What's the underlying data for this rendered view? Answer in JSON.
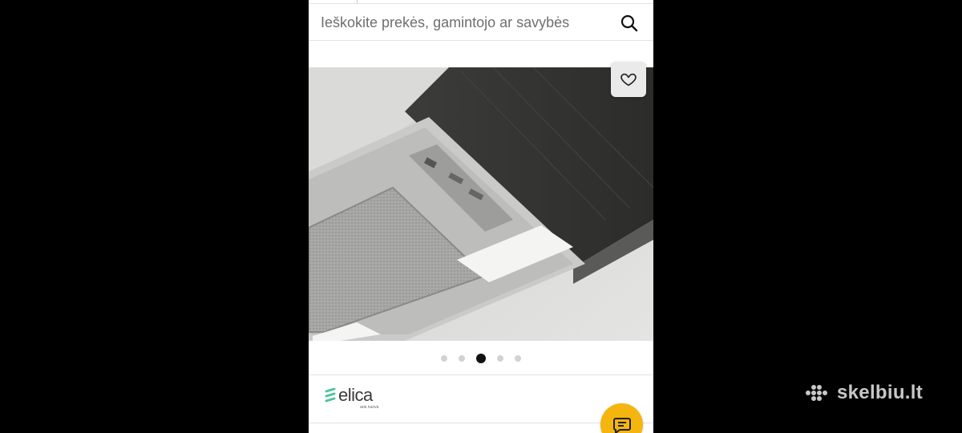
{
  "search": {
    "placeholder": "Ieškokite prekės, gamintojo ar savybės"
  },
  "gallery": {
    "image_alt": "ceiling cooker hood with metal grease filter and lights",
    "dots": [
      {
        "active": false
      },
      {
        "active": false
      },
      {
        "active": true
      },
      {
        "active": false
      },
      {
        "active": false
      }
    ]
  },
  "brand": {
    "name": "elica",
    "tagline": "aria nuova",
    "color": "#4fc3a1"
  },
  "chat": {
    "icon": "chat-bubble-icon",
    "color": "#f5b50f"
  },
  "watermark": {
    "text": "skelbiu.lt"
  },
  "icons": {
    "search": "search-icon",
    "favorite": "heart-icon"
  }
}
